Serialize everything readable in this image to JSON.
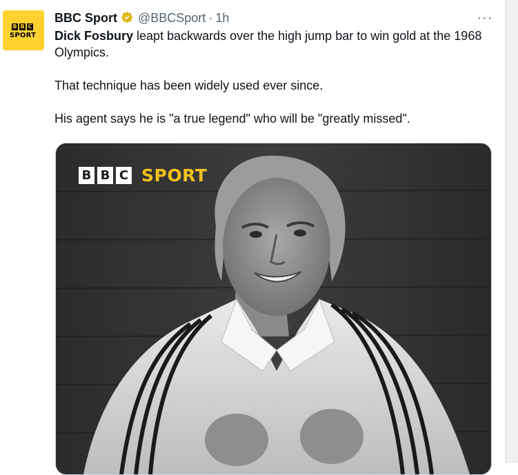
{
  "tweet": {
    "author_name": "BBC Sport",
    "handle": "@BBCSport",
    "separator": "·",
    "time": "1h",
    "more_label": "···",
    "body": {
      "line1_bold": "Dick Fosbury",
      "line1_rest": " leapt backwards over the high jump bar to win gold at the 1968 Olympics.",
      "paragraph2": "That technique has been widely used ever since.",
      "paragraph3": "His agent says he is \"a true legend\" who will be \"greatly missed\"."
    }
  },
  "avatar": {
    "blocks": [
      "B",
      "B",
      "C"
    ],
    "sport": "SPORT"
  },
  "media": {
    "logo_blocks": [
      "B",
      "B",
      "C"
    ],
    "logo_sport": "SPORT"
  },
  "colors": {
    "brand_yellow": "#ffd230",
    "verified_gold": "#e2b719",
    "secondary_text": "#536471"
  },
  "icons": {
    "verified": "verified-badge-icon",
    "more": "more-options-icon"
  }
}
